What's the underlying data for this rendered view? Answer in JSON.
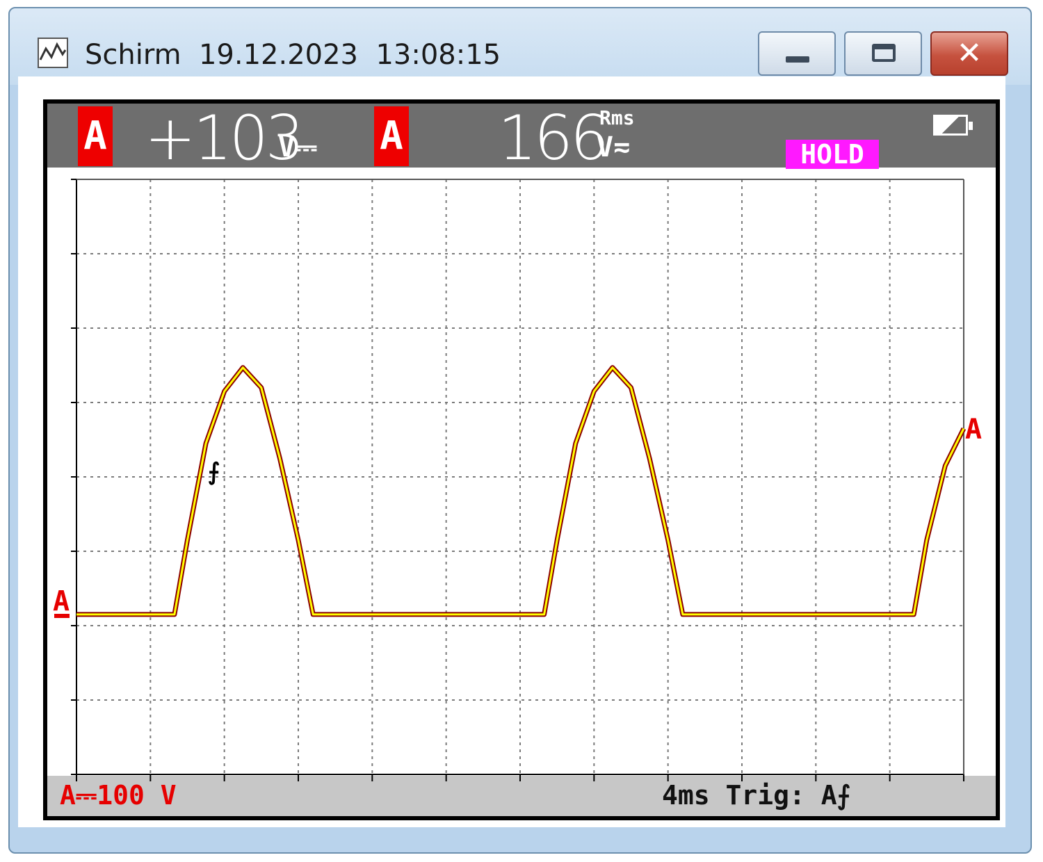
{
  "window": {
    "title": "Schirm  19.12.2023  13:08:15",
    "icon": "scope-screen-icon",
    "buttons": {
      "minimize": "minimize-icon",
      "maximize": "maximize-icon",
      "close_label": "✕"
    }
  },
  "scope": {
    "channel_label": "A",
    "reading_1": {
      "value": "+103",
      "unit": "V⎓"
    },
    "reading_2": {
      "value": "166",
      "unit": "V≂",
      "qualifier": "Rms"
    },
    "hold": "HOLD",
    "battery_icon": "battery-icon",
    "range": "A⎓100 V",
    "timebase": "4ms Trig: A⨍",
    "trigger_marker": "⨍",
    "colors": {
      "trace": "#ffff00",
      "trace_shadow": "#8b0000",
      "marker": "#e60000",
      "hold": "#ff19ff"
    }
  },
  "chart_data": {
    "type": "line",
    "title": "",
    "xlabel": "",
    "ylabel": "",
    "x_unit": "ms",
    "y_unit": "V",
    "x_divisions": 12,
    "y_divisions": 8,
    "grid": true,
    "series": [
      {
        "values": [
          {
            "x": 0.0,
            "y": 0
          },
          {
            "x": 5.3,
            "y": 0
          },
          {
            "x": 6.0,
            "y": 100
          },
          {
            "x": 7.0,
            "y": 230
          },
          {
            "x": 8.0,
            "y": 300
          },
          {
            "x": 9.0,
            "y": 332
          },
          {
            "x": 10.0,
            "y": 305
          },
          {
            "x": 11.0,
            "y": 210
          },
          {
            "x": 12.0,
            "y": 100
          },
          {
            "x": 12.8,
            "y": 0
          },
          {
            "x": 25.3,
            "y": 0
          },
          {
            "x": 26.0,
            "y": 100
          },
          {
            "x": 27.0,
            "y": 230
          },
          {
            "x": 28.0,
            "y": 300
          },
          {
            "x": 29.0,
            "y": 332
          },
          {
            "x": 30.0,
            "y": 305
          },
          {
            "x": 31.0,
            "y": 210
          },
          {
            "x": 32.0,
            "y": 100
          },
          {
            "x": 32.8,
            "y": 0
          },
          {
            "x": 45.3,
            "y": 0
          },
          {
            "x": 46.0,
            "y": 100
          },
          {
            "x": 47.0,
            "y": 200
          },
          {
            "x": 48.0,
            "y": 250
          }
        ]
      }
    ]
  }
}
